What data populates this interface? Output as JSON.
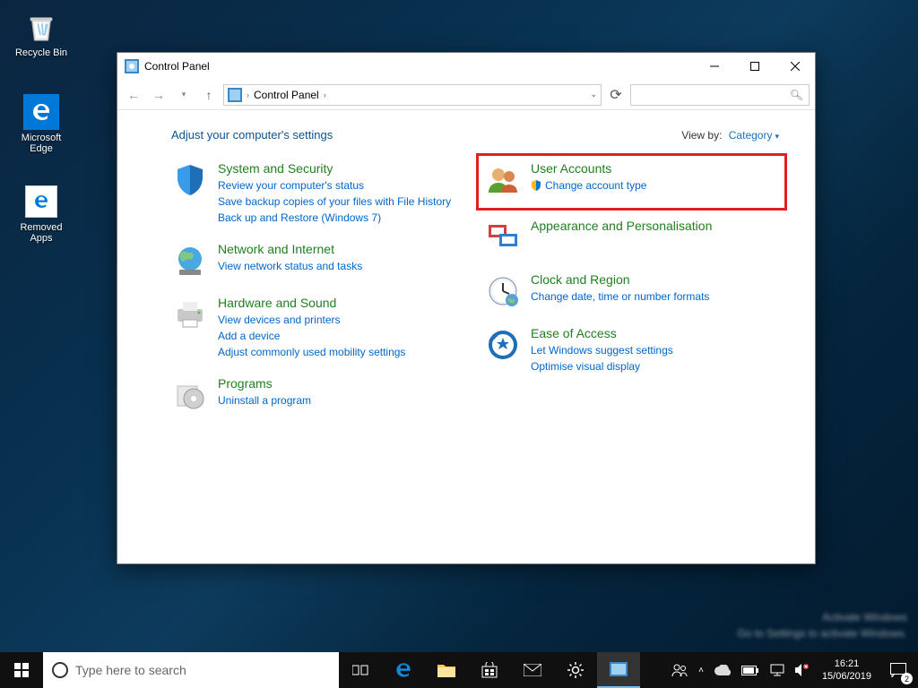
{
  "desktop": {
    "recycle": "Recycle Bin",
    "edge": "Microsoft Edge",
    "removed": "Removed Apps"
  },
  "window": {
    "title": "Control Panel",
    "breadcrumb": "Control Panel",
    "search_placeholder": "",
    "heading": "Adjust your computer's settings",
    "viewby_label": "View by:",
    "viewby_value": "Category"
  },
  "categories": {
    "system": {
      "title": "System and Security",
      "l1": "Review your computer's status",
      "l2": "Save backup copies of your files with File History",
      "l3": "Back up and Restore (Windows 7)"
    },
    "network": {
      "title": "Network and Internet",
      "l1": "View network status and tasks"
    },
    "hardware": {
      "title": "Hardware and Sound",
      "l1": "View devices and printers",
      "l2": "Add a device",
      "l3": "Adjust commonly used mobility settings"
    },
    "programs": {
      "title": "Programs",
      "l1": "Uninstall a program"
    },
    "users": {
      "title": "User Accounts",
      "l1": "Change account type"
    },
    "appearance": {
      "title": "Appearance and Personalisation"
    },
    "clock": {
      "title": "Clock and Region",
      "l1": "Change date, time or number formats"
    },
    "ease": {
      "title": "Ease of Access",
      "l1": "Let Windows suggest settings",
      "l2": "Optimise visual display"
    }
  },
  "taskbar": {
    "search_placeholder": "Type here to search",
    "time": "16:21",
    "date": "15/06/2019",
    "notif_count": "2"
  },
  "watermark": {
    "l1": "Activate Windows",
    "l2": "Go to Settings to activate Windows."
  }
}
